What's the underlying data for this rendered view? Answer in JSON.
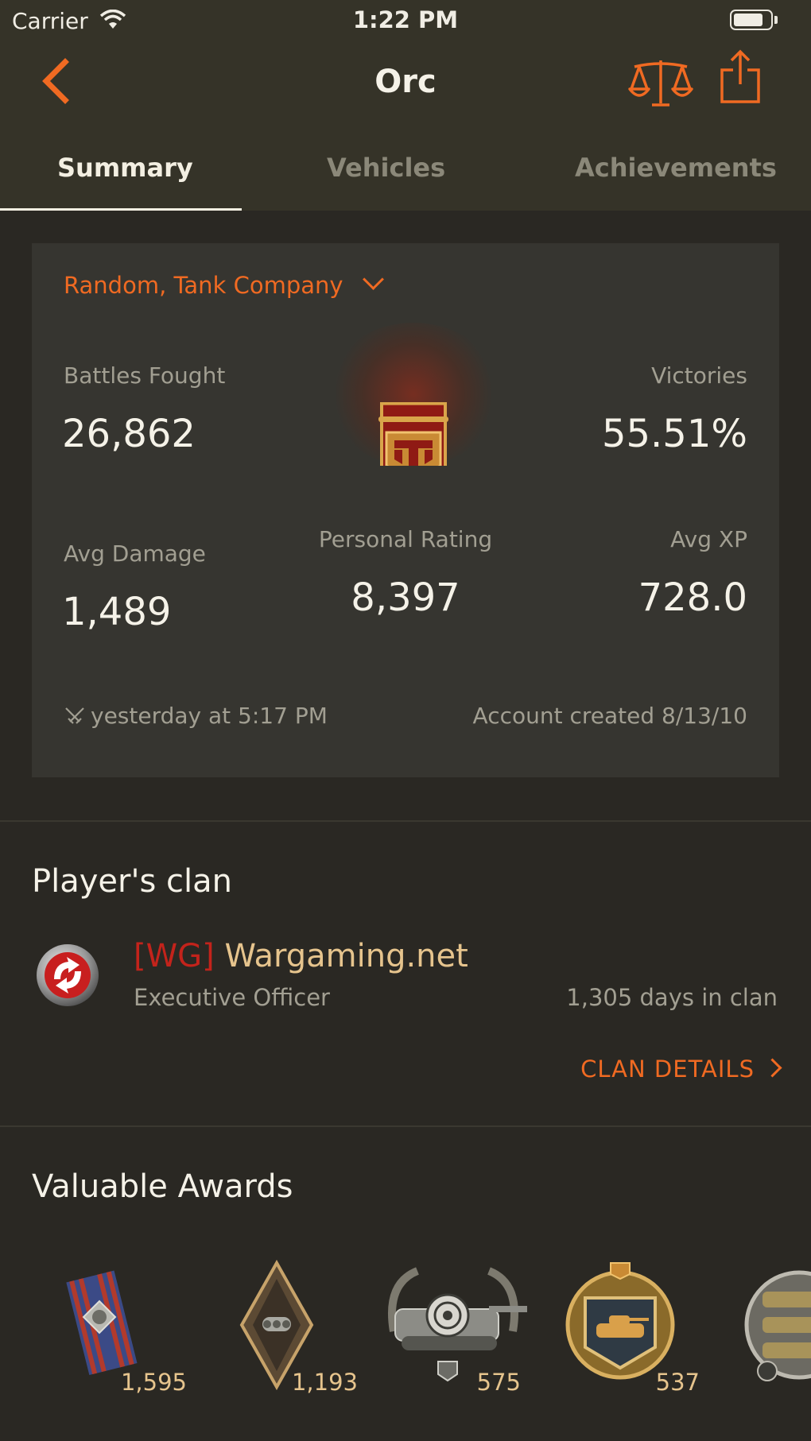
{
  "status_bar": {
    "carrier": "Carrier",
    "time": "1:22 PM"
  },
  "nav": {
    "title": "Orc"
  },
  "tabs": [
    {
      "label": "Summary",
      "active": true
    },
    {
      "label": "Vehicles",
      "active": false
    },
    {
      "label": "Achievements",
      "active": false
    }
  ],
  "stats": {
    "mode": "Random, Tank Company",
    "battles_label": "Battles Fought",
    "battles_value": "26,862",
    "victories_label": "Victories",
    "victories_value": "55.51%",
    "avg_damage_label": "Avg Damage",
    "avg_damage_value": "1,489",
    "personal_rating_label": "Personal Rating",
    "personal_rating_value": "8,397",
    "avg_xp_label": "Avg XP",
    "avg_xp_value": "728.0",
    "last_battle": "yesterday at 5:17 PM",
    "account_created": "Account created 8/13/10"
  },
  "clan": {
    "section_title": "Player's clan",
    "tag": "[WG]",
    "name": "Wargaming.net",
    "role": "Executive Officer",
    "days": "1,305 days in clan",
    "details_label": "CLAN DETAILS"
  },
  "awards": {
    "section_title": "Valuable Awards",
    "items": [
      {
        "icon": "ribbon-medal-icon",
        "count": "1,595"
      },
      {
        "icon": "diamond-badge-icon",
        "count": "1,193"
      },
      {
        "icon": "sniper-tank-badge-icon",
        "count": "575"
      },
      {
        "icon": "tank-shield-badge-icon",
        "count": "537"
      },
      {
        "icon": "tank-wreath-badge-icon",
        "count": ""
      }
    ]
  },
  "colors": {
    "accent": "#f06a22",
    "background": "#2a2823",
    "header": "#353328",
    "card": "#363530",
    "clan_tag": "#c3231b",
    "gold": "#e6c48d"
  }
}
